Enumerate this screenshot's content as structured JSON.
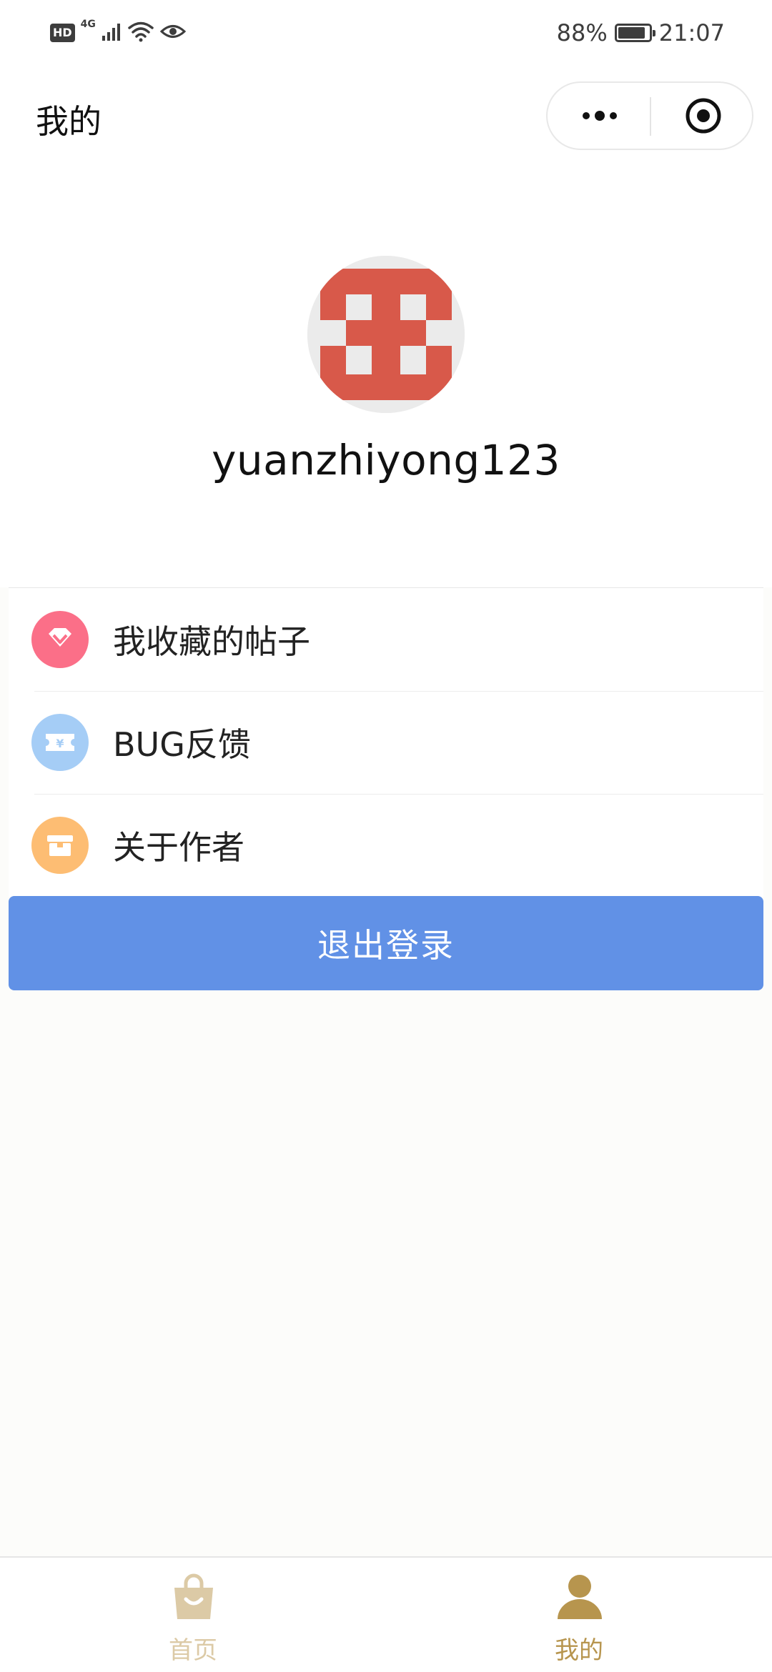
{
  "status_bar": {
    "hd": "HD",
    "network": "4G",
    "battery": "88%",
    "time": "21:07"
  },
  "nav": {
    "title": "我的"
  },
  "profile": {
    "username": "yuanzhiyong123"
  },
  "menu": {
    "items": [
      {
        "label": "我收藏的帖子",
        "icon": "diamond-icon",
        "color": "#fb6f88"
      },
      {
        "label": "BUG反馈",
        "icon": "ticket-icon",
        "color": "#a5cdf6"
      },
      {
        "label": "关于作者",
        "icon": "archive-box-icon",
        "color": "#fdbd73"
      }
    ]
  },
  "logout": {
    "label": "退出登录",
    "color": "#6191e6"
  },
  "tabbar": {
    "items": [
      {
        "label": "首页",
        "icon": "shopping-bag-icon",
        "active": false
      },
      {
        "label": "我的",
        "icon": "user-icon",
        "active": true
      }
    ],
    "active_color": "#b7954e",
    "inactive_color": "#dccaa6"
  }
}
